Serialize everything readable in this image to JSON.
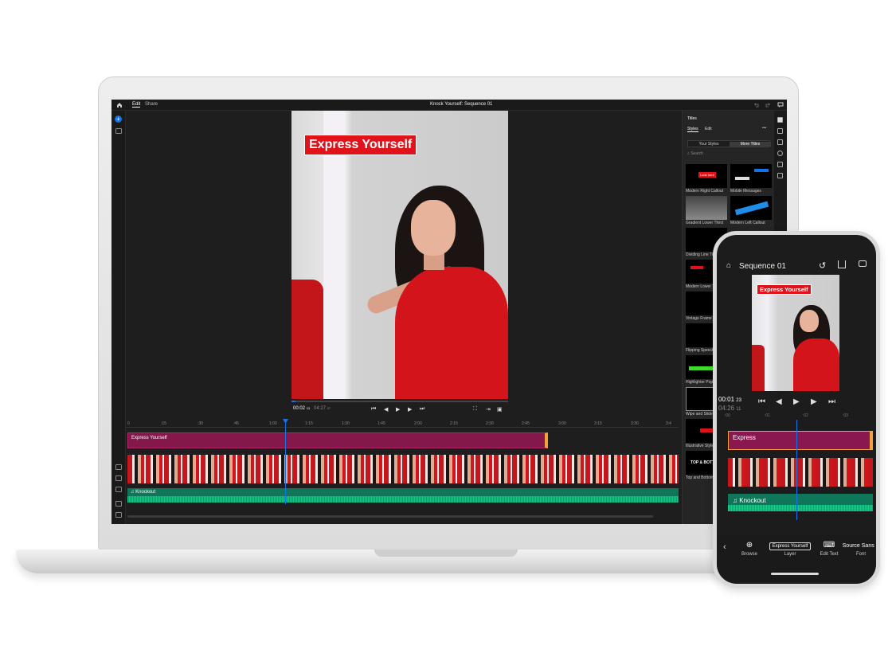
{
  "laptop": {
    "tabs": [
      "Edit",
      "Share"
    ],
    "doc_title": "Knock Yourself: Sequence 01",
    "video_title": "Express Yourself",
    "timecode_current": "00:02",
    "timecode_current_frames": "13",
    "timecode_duration": "04:27",
    "timecode_duration_frames": "07",
    "ruler_ticks": [
      "0",
      ":15",
      ":30",
      ":45",
      "1:00",
      "1:15",
      "1:30",
      "1:45",
      "2:00",
      "2:15",
      "2:30",
      "2:45",
      "3:00",
      "3:15",
      "3:30",
      "3:4"
    ],
    "tracks": {
      "title_clip": "Express Yourself",
      "audio_clip": "Knockout"
    },
    "panel": {
      "title": "Titles",
      "tabs": [
        "Styles",
        "Edit"
      ],
      "segment": [
        "Your Styles",
        "More Titles"
      ],
      "search_placeholder": "Search",
      "thumbs": [
        {
          "label": "Modern Right Callout",
          "text": "Look here"
        },
        {
          "label": "Mobile Messages"
        },
        {
          "label": "Gradient Lower Third"
        },
        {
          "label": "Modern Left Callout"
        },
        {
          "label": "Dividing Line Title"
        },
        {
          "label": "Modern Lower Third"
        },
        {
          "label": "Vintage Frame Overlay"
        },
        {
          "label": "Flipping Speech Bubble"
        },
        {
          "label": "Highlighter Pop Up"
        },
        {
          "label": "Wipe and Slide Lower"
        },
        {
          "label": "Illustrative Style"
        },
        {
          "label": "Top and Bottom",
          "text": "TOP & BOTTOM"
        }
      ]
    }
  },
  "phone": {
    "title": "Sequence 01",
    "video_title": "Express Yourself",
    "timecode_current": "00:01",
    "timecode_current_frames": "23",
    "timecode_duration": "04:26",
    "timecode_duration_frames": "11",
    "ruler_ticks": [
      ":00",
      ":01",
      ":02",
      ":03"
    ],
    "title_clip": "Express",
    "audio_clip": "Knockout",
    "bottom": {
      "browse": "Browse",
      "layer_box": "Express Yourself",
      "layer": "Layer",
      "edit_text": "Edit Text",
      "font_value": "Source Sans P",
      "font": "Font"
    }
  },
  "colors": {
    "accent": "#1473e6",
    "title_red": "#e0121a",
    "clip_magenta": "#85184a",
    "audio_green": "#10765a"
  }
}
